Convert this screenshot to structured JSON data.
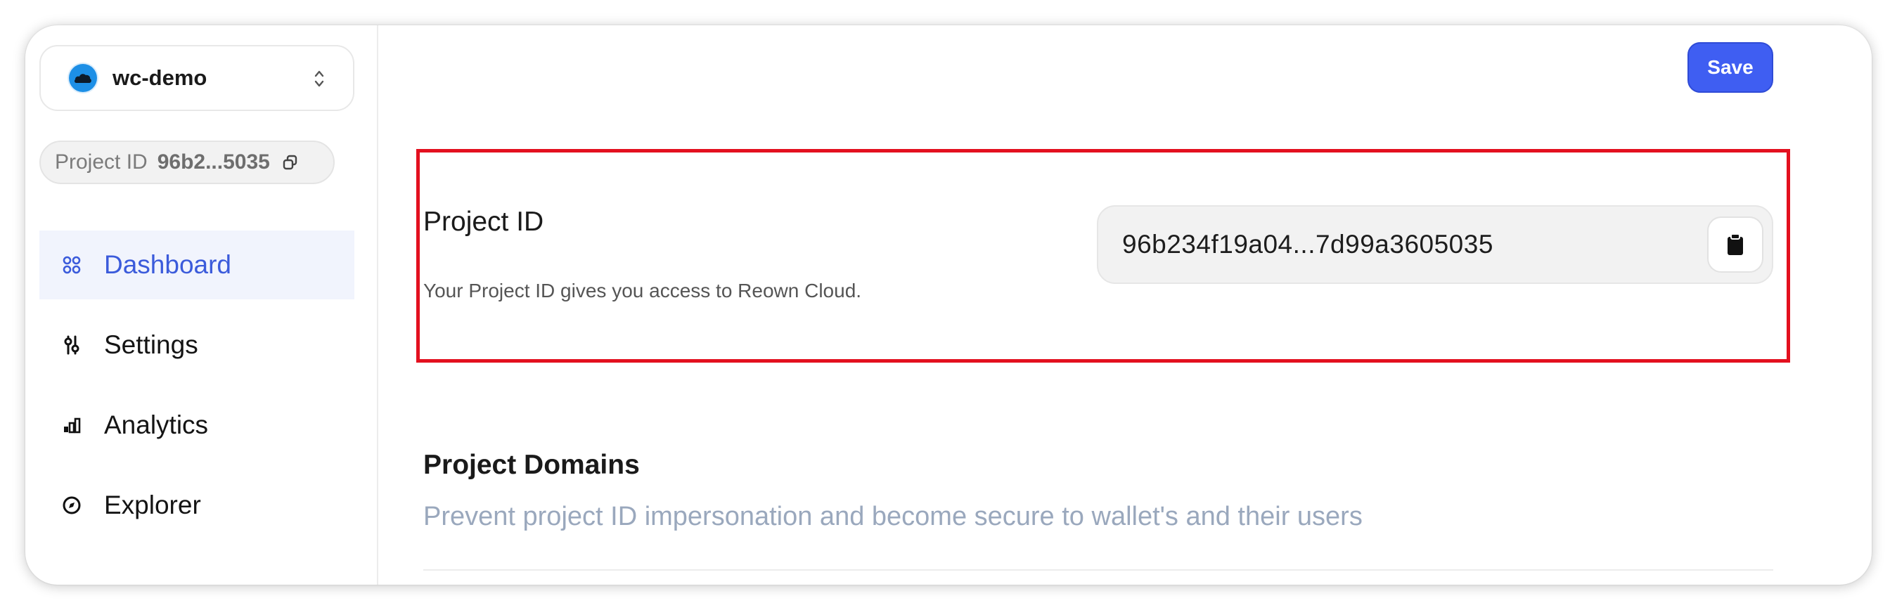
{
  "project": {
    "name": "wc-demo",
    "avatar_icon": "cloud-icon",
    "avatar_color": "#1d8fe6"
  },
  "sidebar": {
    "project_id_chip": {
      "label": "Project ID",
      "value": "96b2...5035"
    },
    "items": [
      {
        "label": "Dashboard",
        "icon": "grid-icon",
        "active": true
      },
      {
        "label": "Settings",
        "icon": "sliders-icon",
        "active": false
      },
      {
        "label": "Analytics",
        "icon": "bar-chart-icon",
        "active": false
      },
      {
        "label": "Explorer",
        "icon": "compass-icon",
        "active": false
      }
    ]
  },
  "toolbar": {
    "save_label": "Save"
  },
  "project_id_section": {
    "title": "Project ID",
    "description": "Your Project ID gives you access to Reown Cloud.",
    "value": "96b234f19a04...7d99a3605035"
  },
  "domains_section": {
    "title": "Project Domains",
    "subtitle": "Prevent project ID impersonation and become secure to wallet's and their users"
  },
  "colors": {
    "accent": "#3f5ef2",
    "highlight": "#e3101f",
    "active_nav_bg": "#f1f4fd",
    "active_nav_text": "#3b5bdb"
  }
}
